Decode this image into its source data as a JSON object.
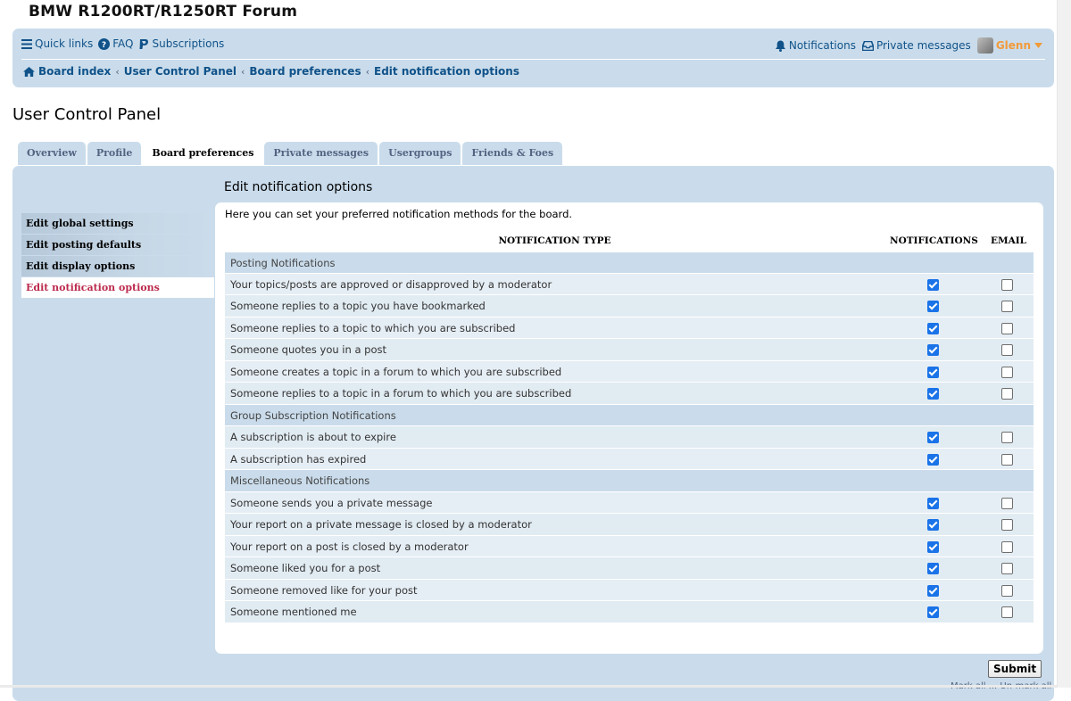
{
  "site": {
    "title": "BMW R1200RT/R1250RT Forum"
  },
  "nav": {
    "quick_links": "Quick links",
    "faq": "FAQ",
    "subscriptions": "Subscriptions",
    "notifications": "Notifications",
    "private_messages": "Private messages",
    "username": "Glenn"
  },
  "breadcrumbs": [
    "Board index",
    "User Control Panel",
    "Board preferences",
    "Edit notification options"
  ],
  "page": {
    "title": "User Control Panel"
  },
  "tabs": [
    {
      "label": "Overview",
      "active": false
    },
    {
      "label": "Profile",
      "active": false
    },
    {
      "label": "Board preferences",
      "active": true
    },
    {
      "label": "Private messages",
      "active": false
    },
    {
      "label": "Usergroups",
      "active": false
    },
    {
      "label": "Friends & Foes",
      "active": false
    }
  ],
  "side_menu": [
    {
      "label": "Edit global settings",
      "active": false
    },
    {
      "label": "Edit posting defaults",
      "active": false
    },
    {
      "label": "Edit display options",
      "active": false
    },
    {
      "label": "Edit notification options",
      "active": true
    }
  ],
  "content": {
    "title": "Edit notification options",
    "intro": "Here you can set your preferred notification methods for the board."
  },
  "table": {
    "headers": {
      "type": "NOTIFICATION TYPE",
      "notifications": "NOTIFICATIONS",
      "email": "EMAIL"
    },
    "rows": [
      {
        "kind": "section",
        "label": "Posting Notifications"
      },
      {
        "kind": "option",
        "label": "Your topics/posts are approved or disapproved by a moderator",
        "notify": true,
        "email": false
      },
      {
        "kind": "option",
        "label": "Someone replies to a topic you have bookmarked",
        "notify": true,
        "email": false
      },
      {
        "kind": "option",
        "label": "Someone replies to a topic to which you are subscribed",
        "notify": true,
        "email": false
      },
      {
        "kind": "option",
        "label": "Someone quotes you in a post",
        "notify": true,
        "email": false
      },
      {
        "kind": "option",
        "label": "Someone creates a topic in a forum to which you are subscribed",
        "notify": true,
        "email": false
      },
      {
        "kind": "option",
        "label": "Someone replies to a topic in a forum to which you are subscribed",
        "notify": true,
        "email": false
      },
      {
        "kind": "section",
        "label": "Group Subscription Notifications"
      },
      {
        "kind": "option",
        "label": "A subscription is about to expire",
        "notify": true,
        "email": false
      },
      {
        "kind": "option",
        "label": "A subscription has expired",
        "notify": true,
        "email": false
      },
      {
        "kind": "section",
        "label": "Miscellaneous Notifications"
      },
      {
        "kind": "option",
        "label": "Someone sends you a private message",
        "notify": true,
        "email": false
      },
      {
        "kind": "option",
        "label": "Your report on a private message is closed by a moderator",
        "notify": true,
        "email": false
      },
      {
        "kind": "option",
        "label": "Your report on a post is closed by a moderator",
        "notify": true,
        "email": false
      },
      {
        "kind": "option",
        "label": "Someone liked you for a post",
        "notify": true,
        "email": false
      },
      {
        "kind": "option",
        "label": "Someone removed like for your post",
        "notify": true,
        "email": false
      },
      {
        "kind": "option",
        "label": "Someone mentioned me",
        "notify": true,
        "email": false
      }
    ]
  },
  "actions": {
    "submit": "Submit"
  },
  "footer": {
    "partial_link": "Mark all ... Un-mark all"
  }
}
